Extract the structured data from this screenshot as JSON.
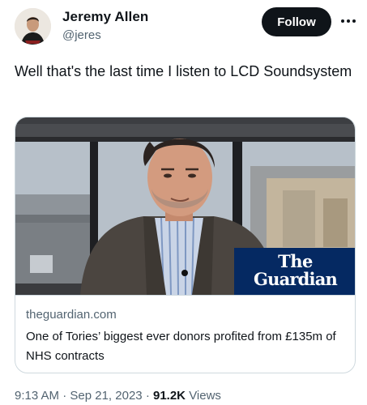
{
  "author": {
    "name": "Jeremy Allen",
    "handle": "@jeres",
    "avatar_icon": "profile-avatar"
  },
  "follow_label": "Follow",
  "more_icon": "more-horizontal-icon",
  "tweet_text": "Well that's the last time I listen to LCD Soundsystem",
  "card": {
    "image_icon": "news-video-still",
    "logo_line1": "The",
    "logo_line2": "Guardian",
    "domain": "theguardian.com",
    "title": "One of Tories’ biggest ever donors profited from £135m of NHS contracts"
  },
  "footer": {
    "time": "9:13 AM",
    "sep1": "·",
    "date": "Sep 21, 2023",
    "sep2": "·",
    "views_count": "91.2K",
    "views_label": "Views"
  },
  "colors": {
    "text_primary": "#0f1419",
    "text_secondary": "#536471",
    "border": "#cfd9de",
    "guardian_blue": "#052962"
  }
}
